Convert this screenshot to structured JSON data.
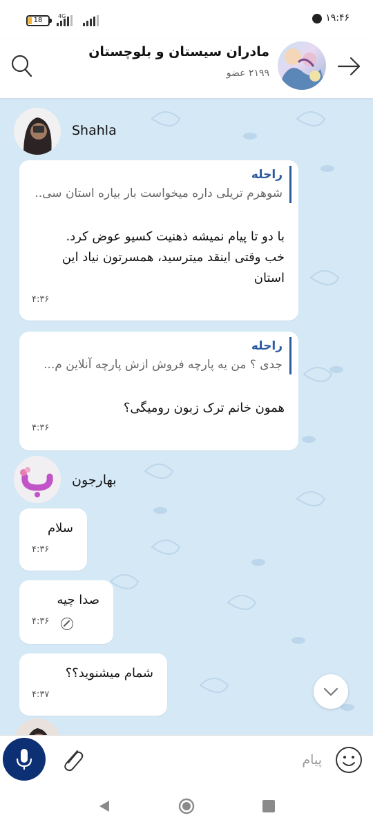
{
  "status_bar": {
    "battery": "18",
    "network": "4G",
    "time": "۱۹:۴۶"
  },
  "header": {
    "title": "مادران سیستان و بلوچستان",
    "members": "۲۱۹۹ عضو"
  },
  "messages": [
    {
      "sender": "Shahla",
      "bubbles": [
        {
          "quote_name": "راحله",
          "quote_text": "شوهرم تریلی داره میخواست بار بیاره استان سی..",
          "text_lines": [
            "با دو تا پیام نمیشه ذهنیت کسیو عوض کرد.",
            "خب وقتی اینقد میترسید، همسرتون نیاد این",
            "استان"
          ],
          "time": "۴:۳۶"
        },
        {
          "quote_name": "راحله",
          "quote_text": "جدی ؟ من یه پارچه فروش ازش پارچه آنلاین م...",
          "text_lines": [
            "همون خانم ترک زبون رومیگی؟"
          ],
          "time": "۴:۳۶"
        }
      ]
    },
    {
      "sender": "بهارجون",
      "bubbles": [
        {
          "text_lines": [
            "سلام"
          ],
          "time": "۴:۳۶"
        },
        {
          "text_lines": [
            "صدا چیه"
          ],
          "time": "۴:۳۶",
          "edited": true
        },
        {
          "text_lines": [
            "شمام میشنوید؟؟"
          ],
          "time": "۴:۳۷"
        }
      ]
    }
  ],
  "input": {
    "placeholder": "پیام"
  },
  "icons": {
    "back": "arrow-right-icon",
    "search": "search-icon",
    "mic": "microphone-icon",
    "attach": "paperclip-icon",
    "emoji": "smiley-icon",
    "scroll": "chevron-down-icon"
  },
  "colors": {
    "chat_background": "#d5e8f6",
    "accent": "#2b5aa0",
    "mic_button": "#0d2f73"
  }
}
